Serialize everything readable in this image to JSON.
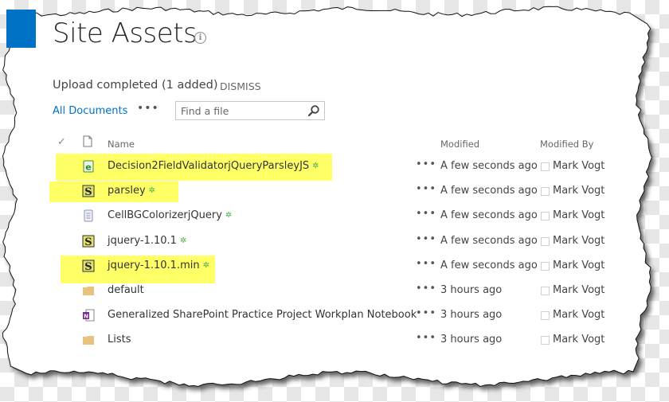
{
  "page": {
    "title": "Site Assets",
    "info_icon": "info-icon",
    "brand_color": "#0072c6",
    "highlight_color": "#ffff66"
  },
  "notification": {
    "message": "Upload completed (1 added)",
    "dismiss_label": "DISMISS"
  },
  "toolbar": {
    "view_label": "All Documents",
    "more_label": "•••",
    "search_placeholder": "Find a file",
    "search_icon": "search-icon"
  },
  "columns": {
    "check": "✓",
    "type_icon": "document-icon",
    "name": "Name",
    "modified": "Modified",
    "modified_by": "Modified By"
  },
  "rows": [
    {
      "name": "Decision2FieldValidatorjQueryParsleyJS",
      "icon": "html-file-icon",
      "is_new": true,
      "highlighted": true,
      "modified": "A few seconds ago",
      "modified_by": "Mark Vogt",
      "more": "•••",
      "new_badge": "✲"
    },
    {
      "name": "parsley",
      "icon": "js-file-icon",
      "is_new": true,
      "highlighted": true,
      "modified": "A few seconds ago",
      "modified_by": "Mark Vogt",
      "more": "•••",
      "new_badge": "✲"
    },
    {
      "name": "CellBGColorizerjQuery",
      "icon": "text-file-icon",
      "is_new": true,
      "highlighted": false,
      "modified": "A few seconds ago",
      "modified_by": "Mark Vogt",
      "more": "•••",
      "new_badge": "✲"
    },
    {
      "name": "jquery-1.10.1",
      "icon": "js-file-icon",
      "is_new": true,
      "highlighted": false,
      "modified": "A few seconds ago",
      "modified_by": "Mark Vogt",
      "more": "•••",
      "new_badge": "✲"
    },
    {
      "name": "jquery-1.10.1.min",
      "icon": "js-file-icon",
      "is_new": true,
      "highlighted": true,
      "modified": "A few seconds ago",
      "modified_by": "Mark Vogt",
      "more": "•••",
      "new_badge": "✲"
    },
    {
      "name": "default",
      "icon": "folder-icon",
      "is_new": false,
      "highlighted": false,
      "modified": "3 hours ago",
      "modified_by": "Mark Vogt",
      "more": "•••",
      "new_badge": ""
    },
    {
      "name": "Generalized SharePoint Practice Project Workplan Notebook",
      "icon": "onenote-icon",
      "is_new": false,
      "highlighted": false,
      "modified": "3 hours ago",
      "modified_by": "Mark Vogt",
      "more": "•••",
      "new_badge": ""
    },
    {
      "name": "Lists",
      "icon": "folder-icon",
      "is_new": false,
      "highlighted": false,
      "modified": "3 hours ago",
      "modified_by": "Mark Vogt",
      "more": "•••",
      "new_badge": ""
    }
  ]
}
